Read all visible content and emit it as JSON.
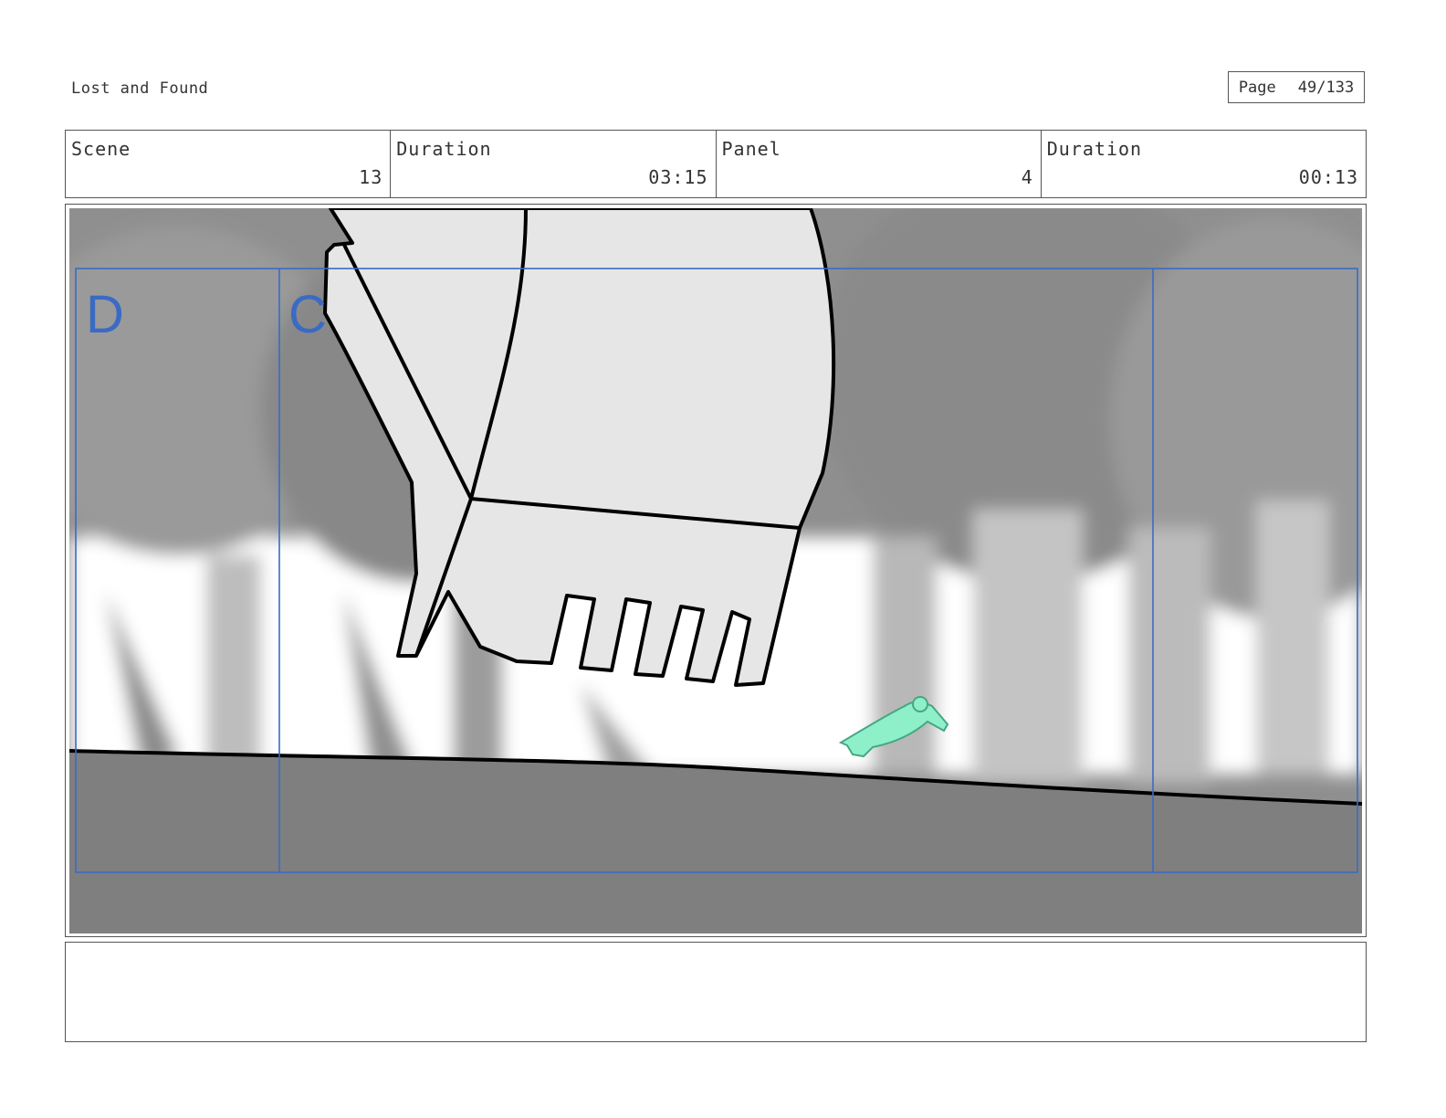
{
  "header": {
    "project_title": "Lost and Found",
    "page_label": "Page",
    "page_value": "49/133"
  },
  "info": {
    "scene_label": "Scene",
    "scene_value": "13",
    "scene_duration_label": "Duration",
    "scene_duration_value": "03:15",
    "panel_label": "Panel",
    "panel_value": "4",
    "panel_duration_label": "Duration",
    "panel_duration_value": "00:13"
  },
  "panel": {
    "field_guide_label_outer": "D",
    "field_guide_label_inner": "C",
    "colors": {
      "guide_blue": "#3a6bc4",
      "frog_green": "#8ef0c8",
      "ground_gray": "#7f7f7f",
      "bucket_gray": "#e6e6e6"
    }
  },
  "caption": {
    "text": ""
  }
}
